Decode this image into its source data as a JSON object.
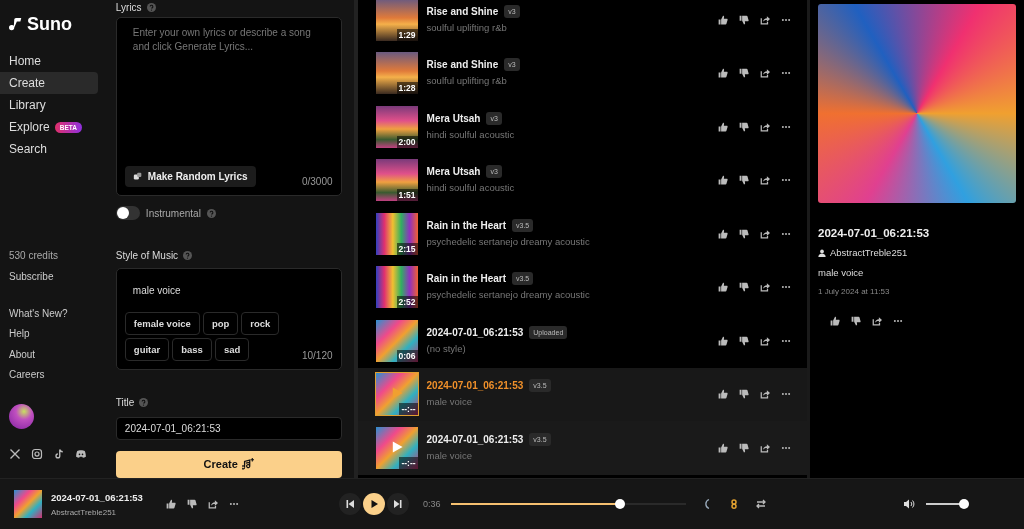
{
  "brand": "Suno",
  "nav": [
    {
      "label": "Home",
      "selected": false
    },
    {
      "label": "Create",
      "selected": true
    },
    {
      "label": "Library",
      "selected": false
    },
    {
      "label": "Explore",
      "selected": false,
      "badge": "BETA"
    },
    {
      "label": "Search",
      "selected": false
    }
  ],
  "credits": "530 credits",
  "subscribe": "Subscribe",
  "links": [
    "What's New?",
    "Help",
    "About",
    "Careers"
  ],
  "create": {
    "lyrics": {
      "label": "Lyrics",
      "placeholder": "Enter your own lyrics or describe a song and click Generate Lyrics...",
      "random_button": "Make Random Lyrics",
      "counter": "0/3000"
    },
    "instrumental": {
      "label": "Instrumental",
      "on": false
    },
    "style": {
      "label": "Style of Music",
      "value": "male voice",
      "tags": [
        "female voice",
        "pop",
        "rock",
        "guitar",
        "bass",
        "sad"
      ],
      "counter": "10/120"
    },
    "title": {
      "label": "Title",
      "value": "2024-07-01_06:21:53"
    },
    "create_button": "Create"
  },
  "songs": [
    {
      "title": "Rise and Shine",
      "tag": "v3",
      "style": "soulful uplifting r&b",
      "duration": "1:29",
      "selected": false,
      "hovered": false
    },
    {
      "title": "Rise and Shine",
      "tag": "v3",
      "style": "soulful uplifting r&b",
      "duration": "1:28",
      "selected": false,
      "hovered": false
    },
    {
      "title": "Mera Utsah",
      "tag": "v3",
      "style": "hindi soulful acoustic",
      "duration": "2:00",
      "selected": false,
      "hovered": false
    },
    {
      "title": "Mera Utsah",
      "tag": "v3",
      "style": "hindi soulful acoustic",
      "duration": "1:51",
      "selected": false,
      "hovered": false
    },
    {
      "title": "Rain in the Heart",
      "tag": "v3.5",
      "style": "psychedelic sertanejo dreamy acoustic",
      "duration": "2:15",
      "selected": false,
      "hovered": false
    },
    {
      "title": "Rain in the Heart",
      "tag": "v3.5",
      "style": "psychedelic sertanejo dreamy acoustic",
      "duration": "2:52",
      "selected": false,
      "hovered": false
    },
    {
      "title": "2024-07-01_06:21:53",
      "tag": "Uploaded",
      "style": "(no style)",
      "duration": "0:06",
      "selected": false,
      "hovered": false
    },
    {
      "title": "2024-07-01_06:21:53",
      "tag": "v3.5",
      "style": "male voice",
      "duration": "--:--",
      "selected": true,
      "hovered": false
    },
    {
      "title": "2024-07-01_06:21:53",
      "tag": "v3.5",
      "style": "male voice",
      "duration": "--:--",
      "selected": false,
      "hovered": true
    }
  ],
  "detail": {
    "title": "2024-07-01_06:21:53",
    "author": "AbstractTreble251",
    "style": "male voice",
    "date": "1 July 2024 at 11:53"
  },
  "player": {
    "title": "2024-07-01_06:21:53",
    "artist": "AbstractTreble251",
    "elapsed": "0:36",
    "level": 0.72,
    "volume": {
      "level": 0.95
    }
  }
}
